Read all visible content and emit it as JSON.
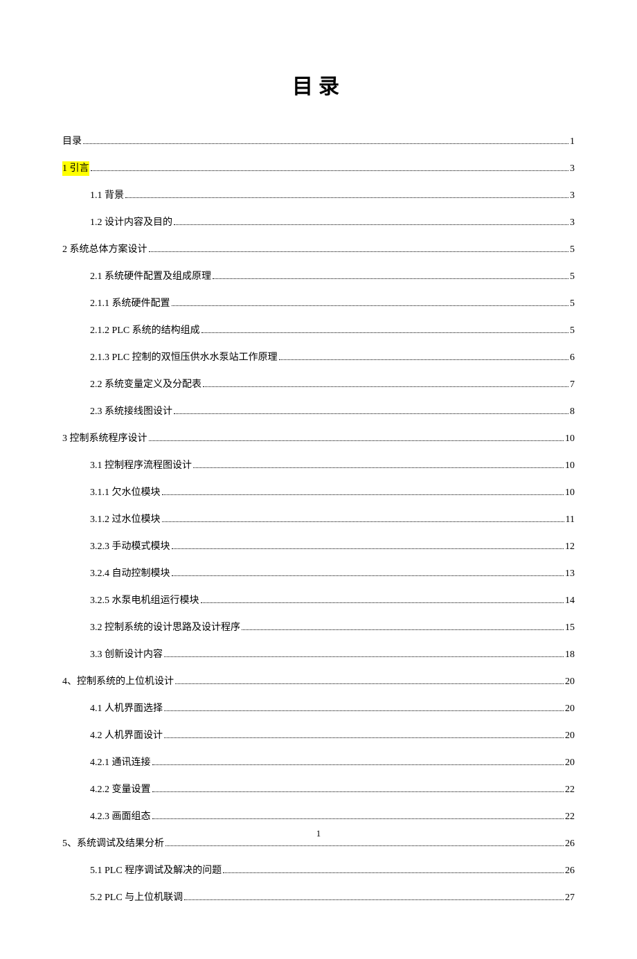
{
  "title": "目录",
  "footer_page": "1",
  "toc": [
    {
      "label": "目录",
      "page": "1",
      "level": 0,
      "highlight": false
    },
    {
      "label": "1 引言",
      "page": "3",
      "level": 0,
      "highlight": true
    },
    {
      "label": "1.1 背景",
      "page": "3",
      "level": 1,
      "highlight": false
    },
    {
      "label": "1.2 设计内容及目的",
      "page": "3",
      "level": 1,
      "highlight": false
    },
    {
      "label": "2 系统总体方案设计",
      "page": "5",
      "level": 0,
      "highlight": false
    },
    {
      "label": "2.1 系统硬件配置及组成原理",
      "page": "5",
      "level": 1,
      "highlight": false
    },
    {
      "label": "2.1.1 系统硬件配置",
      "page": "5",
      "level": 1,
      "highlight": false
    },
    {
      "label": "2.1.2 PLC 系统的结构组成",
      "page": "5",
      "level": 1,
      "highlight": false
    },
    {
      "label": "2.1.3 PLC 控制的双恒压供水水泵站工作原理",
      "page": "6",
      "level": 1,
      "highlight": false
    },
    {
      "label": "2.2 系统变量定义及分配表",
      "page": "7",
      "level": 1,
      "highlight": false
    },
    {
      "label": "2.3 系统接线图设计",
      "page": "8",
      "level": 1,
      "highlight": false
    },
    {
      "label": "3 控制系统程序设计",
      "page": "10",
      "level": 0,
      "highlight": false
    },
    {
      "label": "3.1 控制程序流程图设计",
      "page": "10",
      "level": 1,
      "highlight": false
    },
    {
      "label": "3.1.1 欠水位模块",
      "page": "10",
      "level": 1,
      "highlight": false
    },
    {
      "label": "3.1.2 过水位模块",
      "page": "11",
      "level": 1,
      "highlight": false
    },
    {
      "label": "3.2.3 手动模式模块",
      "page": "12",
      "level": 1,
      "highlight": false
    },
    {
      "label": "3.2.4 自动控制模块",
      "page": "13",
      "level": 1,
      "highlight": false
    },
    {
      "label": "3.2.5 水泵电机组运行模块",
      "page": "14",
      "level": 1,
      "highlight": false
    },
    {
      "label": "3.2 控制系统的设计思路及设计程序",
      "page": "15",
      "level": 1,
      "highlight": false
    },
    {
      "label": "3.3 创新设计内容",
      "page": "18",
      "level": 1,
      "highlight": false
    },
    {
      "label": "4、控制系统的上位机设计",
      "page": "20",
      "level": 0,
      "highlight": false
    },
    {
      "label": "4.1 人机界面选择",
      "page": "20",
      "level": 1,
      "highlight": false
    },
    {
      "label": "4.2 人机界面设计",
      "page": "20",
      "level": 1,
      "highlight": false
    },
    {
      "label": "4.2.1 通讯连接",
      "page": "20",
      "level": 1,
      "highlight": false
    },
    {
      "label": "4.2.2 变量设置",
      "page": "22",
      "level": 1,
      "highlight": false
    },
    {
      "label": "4.2.3 画面组态",
      "page": "22",
      "level": 1,
      "highlight": false
    },
    {
      "label": "5、系统调试及结果分析",
      "page": "26",
      "level": 0,
      "highlight": false
    },
    {
      "label": "5.1 PLC 程序调试及解决的问题",
      "page": "26",
      "level": 1,
      "highlight": false
    },
    {
      "label": "5.2 PLC 与上位机联调",
      "page": "27",
      "level": 1,
      "highlight": false
    }
  ]
}
